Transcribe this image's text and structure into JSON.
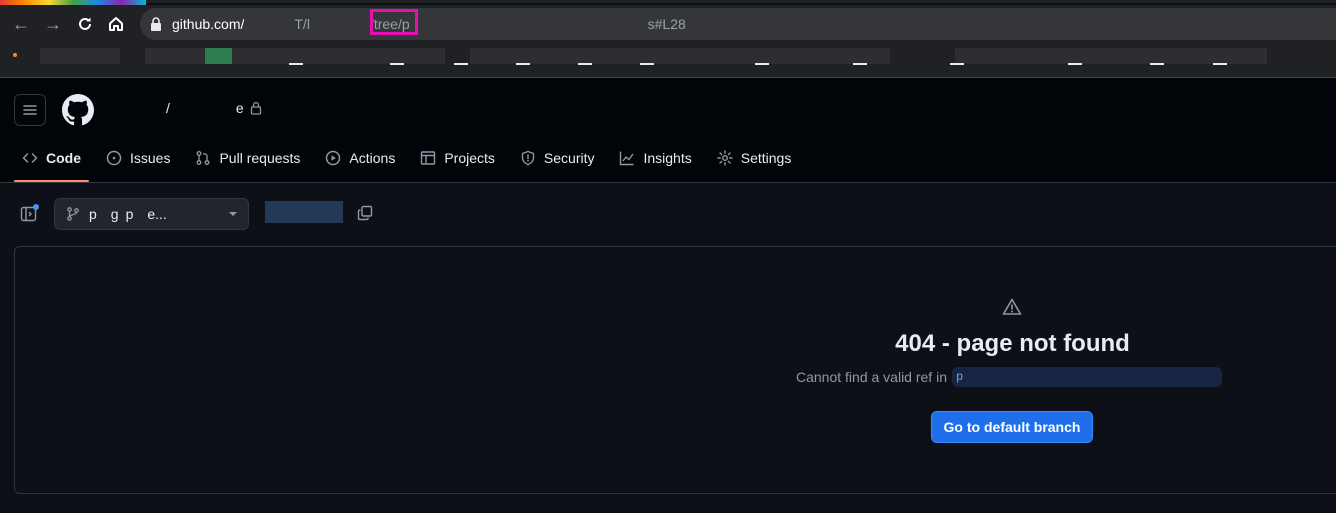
{
  "browser": {
    "url_host": "github.com/",
    "url_seg1": "T/l",
    "url_tree": "/tree/p",
    "url_tail": "s#L28",
    "highlight_color": "#e40fb1"
  },
  "repo": {
    "separator": "/",
    "name_tail": "e"
  },
  "tabs": [
    {
      "label": "Code",
      "icon": "code-icon"
    },
    {
      "label": "Issues",
      "icon": "issue-opened-icon"
    },
    {
      "label": "Pull requests",
      "icon": "git-pull-request-icon"
    },
    {
      "label": "Actions",
      "icon": "play-icon"
    },
    {
      "label": "Projects",
      "icon": "table-icon"
    },
    {
      "label": "Security",
      "icon": "shield-icon"
    },
    {
      "label": "Insights",
      "icon": "graph-icon"
    },
    {
      "label": "Settings",
      "icon": "gear-icon"
    }
  ],
  "branch": {
    "label": "p  g p  e..."
  },
  "not_found": {
    "title": "404 - page not found",
    "message": "Cannot find a valid ref in",
    "ref": "p",
    "button": "Go to default branch"
  },
  "colors": {
    "accent_button": "#1f6feb",
    "tab_underline": "#fd8c73",
    "background": "#0d1117"
  }
}
